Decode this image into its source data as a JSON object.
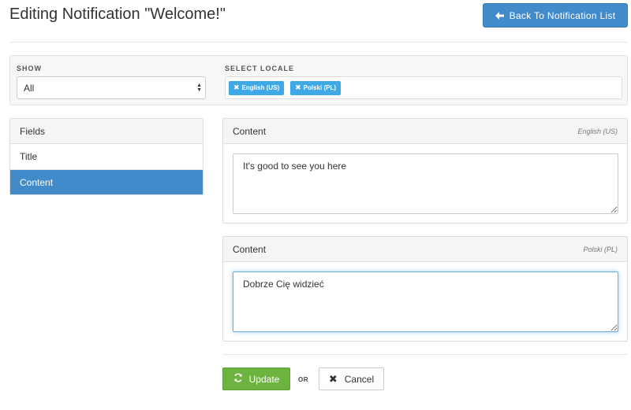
{
  "header": {
    "title": "Editing Notification \"Welcome!\"",
    "back_button": "Back To Notification List"
  },
  "filters": {
    "show_label": "SHOW",
    "show_value": "All",
    "locale_label": "SELECT LOCALE",
    "locales": [
      {
        "label": "English (US)"
      },
      {
        "label": "Polski (PL)"
      }
    ]
  },
  "fields_panel": {
    "header": "Fields",
    "items": [
      {
        "label": "Title",
        "active": false
      },
      {
        "label": "Content",
        "active": true
      }
    ]
  },
  "content_panels": [
    {
      "title": "Content",
      "locale": "English (US)",
      "value": "It's good to see you here"
    },
    {
      "title": "Content",
      "locale": "Polski (PL)",
      "value": "Dobrze Cię widzieć"
    }
  ],
  "actions": {
    "update": "Update",
    "or": "OR",
    "cancel": "Cancel"
  },
  "colors": {
    "primary": "#428bca",
    "chip": "#3fa9e8",
    "success": "#6cb33f"
  }
}
